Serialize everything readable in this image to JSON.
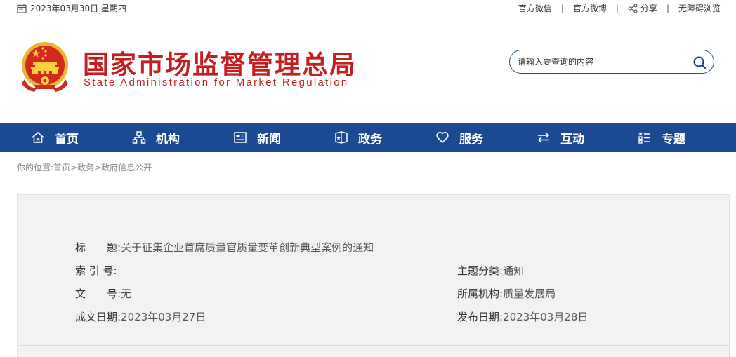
{
  "topbar": {
    "date": "2023年03月30日 星期四",
    "links": {
      "wechat": "官方微信",
      "weibo": "官方微博",
      "share": "分享",
      "accessibility": "无障碍浏览"
    }
  },
  "header": {
    "title": "国家市场监督管理总局",
    "subtitle": "State Administration for Market Regulation",
    "search_placeholder": "请输入要查询的内容"
  },
  "nav": {
    "items": [
      {
        "label": "首页",
        "icon": "home-icon"
      },
      {
        "label": "机构",
        "icon": "org-chart-icon"
      },
      {
        "label": "新闻",
        "icon": "newspaper-icon"
      },
      {
        "label": "政务",
        "icon": "government-icon"
      },
      {
        "label": "服务",
        "icon": "heart-icon"
      },
      {
        "label": "互动",
        "icon": "exchange-arrows-icon"
      },
      {
        "label": "专题",
        "icon": "topic-list-icon"
      }
    ]
  },
  "breadcrumb": "你的位置:首页>政务>政府信息公开",
  "info": {
    "title_label": "标　　题:",
    "title_value": "关于征集企业首席质量官质量变革创新典型案例的通知",
    "index_label": "索 引 号:",
    "index_value": "",
    "topic_label": "主题分类:",
    "topic_value": "通知",
    "doc_no_label": "文　　号:",
    "doc_no_value": "无",
    "org_label": "所属机构:",
    "org_value": "质量发展局",
    "created_label": "成文日期:",
    "created_value": "2023年03月27日",
    "published_label": "发布日期:",
    "published_value": "2023年03月28日"
  },
  "colors": {
    "brand_red": "#c41f1f",
    "nav_blue": "#1b4a93",
    "panel_bg": "#f2f2f2"
  }
}
